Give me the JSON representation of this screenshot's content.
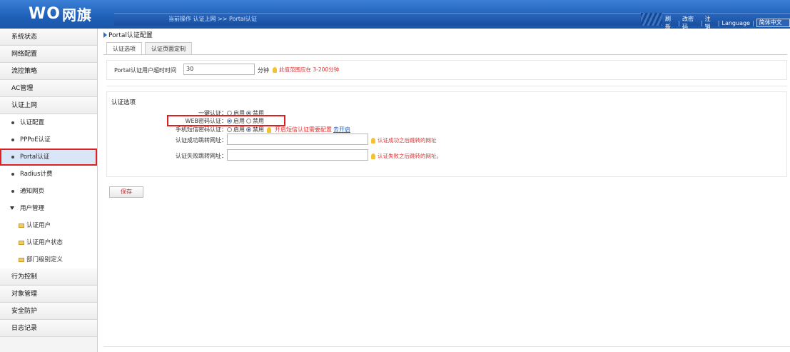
{
  "brand": {
    "logo_latin": "WO",
    "logo_cn": "网旗"
  },
  "header": {
    "breadcrumb": "当前操作 认证上网 >> Portal认证",
    "links": [
      "刷新",
      "改密码",
      "注销",
      "Language"
    ],
    "language_value": "简体中文"
  },
  "sidebar": {
    "top_items": [
      {
        "label": "系统状态"
      },
      {
        "label": "网络配置"
      },
      {
        "label": "流控策略"
      },
      {
        "label": "AC管理"
      },
      {
        "label": "认证上网"
      }
    ],
    "sub_items": [
      {
        "label": "认证配置"
      },
      {
        "label": "PPPoE认证"
      },
      {
        "label": "Portal认证"
      },
      {
        "label": "Radius计费"
      },
      {
        "label": "通知网页"
      }
    ],
    "group": {
      "label": "用户管理"
    },
    "leaf_items": [
      {
        "label": "认证用户"
      },
      {
        "label": "认证用户状态"
      },
      {
        "label": "部门级别定义"
      }
    ],
    "bottom_items": [
      {
        "label": "行为控制"
      },
      {
        "label": "对象管理"
      },
      {
        "label": "安全防护"
      },
      {
        "label": "日志记录"
      }
    ]
  },
  "main": {
    "title": "Portal认证配置",
    "tabs": [
      {
        "label": "认证选项"
      },
      {
        "label": "认证页面定制"
      }
    ],
    "timeout": {
      "label": "Portal认证用户超时时间",
      "value": "30",
      "unit": "分钟",
      "hint": "此值范围应在 3-200分钟"
    },
    "section_title": "认证选项",
    "options": {
      "onekey": {
        "label": "一键认证：",
        "enable": "启用",
        "disable": "禁用",
        "selected": "disable"
      },
      "web": {
        "label": "WEB密码认证：",
        "enable": "启用",
        "disable": "禁用",
        "selected": "enable"
      },
      "sms": {
        "label": "手机短信密码认证：",
        "enable": "启用",
        "disable": "禁用",
        "selected": "disable",
        "hint": "开启短信认证需要配置",
        "link": "去开启"
      },
      "success_url": {
        "label": "认证成功跳转网址：",
        "value": "",
        "hint": "认证成功之后跳转的网址"
      },
      "fail_url": {
        "label": "认证失败跳转网址：",
        "value": "",
        "hint": "认证失败之后跳转的网址。"
      }
    },
    "save_label": "保存"
  },
  "colors": {
    "header_blue": "#1f5fb8",
    "hint_red": "#e03030",
    "highlight_red": "#e02020",
    "active_bg": "#d8e6f8"
  }
}
